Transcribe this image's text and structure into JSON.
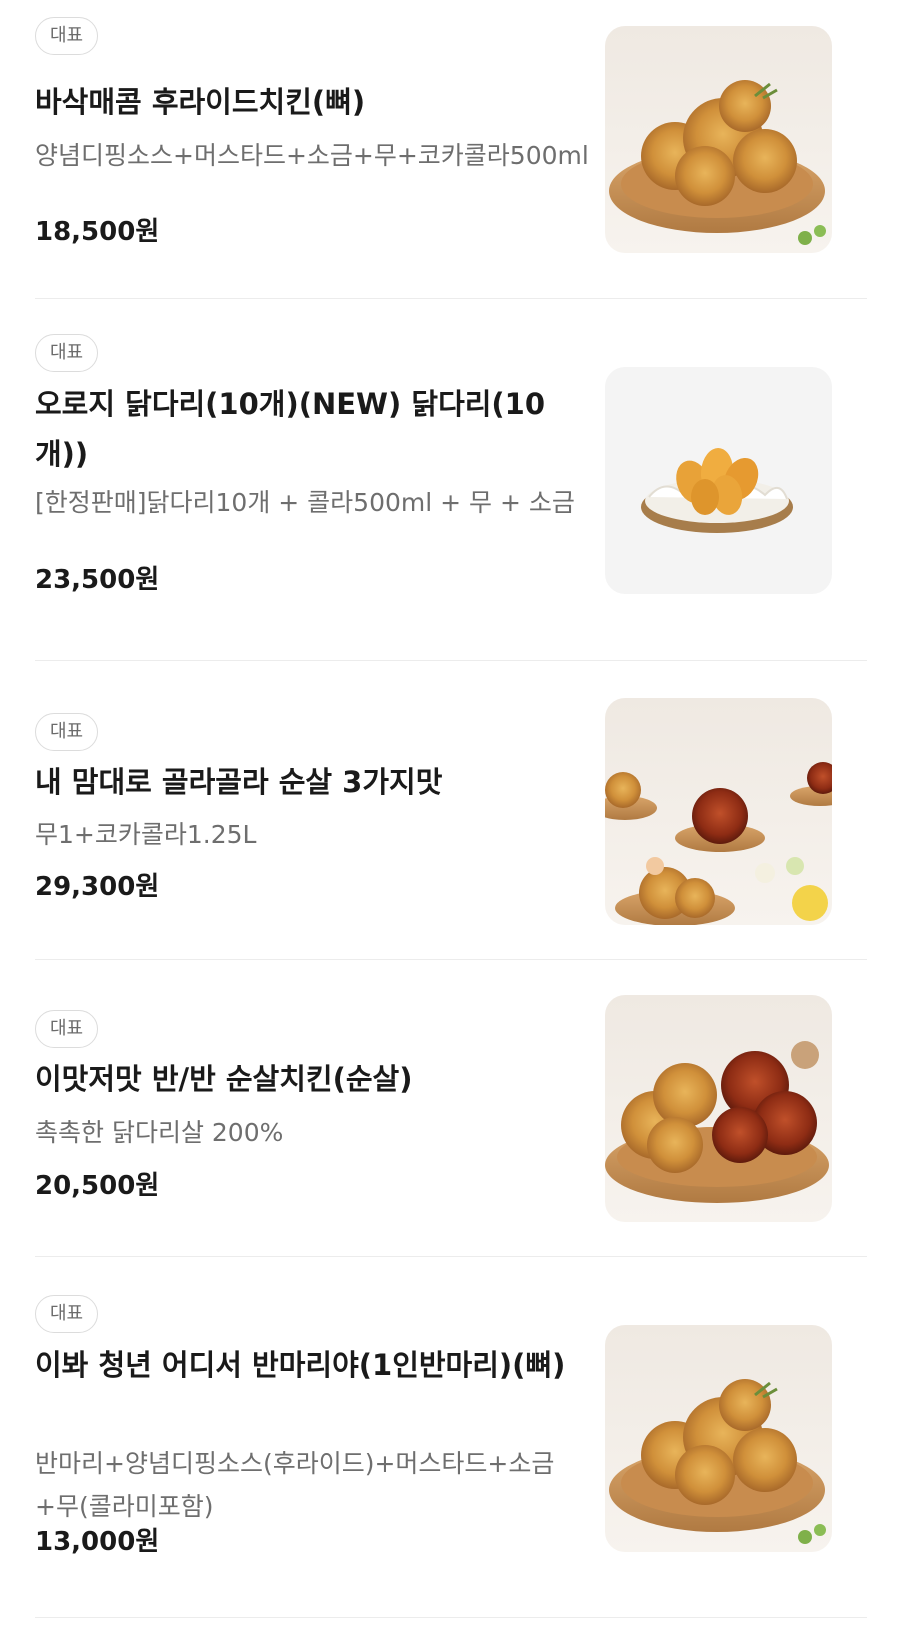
{
  "menu": {
    "items": [
      {
        "badge": "대표",
        "name": "바삭매콤 후라이드치킨(뼈)",
        "description": "양념디핑소스+머스타드+소금+무+코카콜라500ml",
        "price": "18,500원",
        "image_icon": "fried-chicken-plate-icon"
      },
      {
        "badge": "대표",
        "name": "오로지 닭다리(10개)(NEW) 닭다리(10개))",
        "description": "[한정판매]닭다리10개 + 콜라500ml + 무 + 소금",
        "price": "23,500원",
        "image_icon": "drumstick-basket-icon"
      },
      {
        "badge": "대표",
        "name": "내 맘대로 골라골라 순살 3가지맛",
        "description": "무1+코카콜라1.25L",
        "price": "29,300원",
        "image_icon": "chicken-spread-icon"
      },
      {
        "badge": "대표",
        "name": "이맛저맛 반/반 순살치킨(순살)",
        "description": "촉촉한 닭다리살 200%",
        "price": "20,500원",
        "image_icon": "half-half-chicken-icon"
      },
      {
        "badge": "대표",
        "name": "이봐 청년 어디서 반마리야(1인반마리)(뼈)",
        "description": "반마리+양념디핑소스(후라이드)+머스타드+소금+무(콜라미포함)",
        "price": "13,000원",
        "image_icon": "fried-chicken-plate-icon"
      }
    ]
  }
}
